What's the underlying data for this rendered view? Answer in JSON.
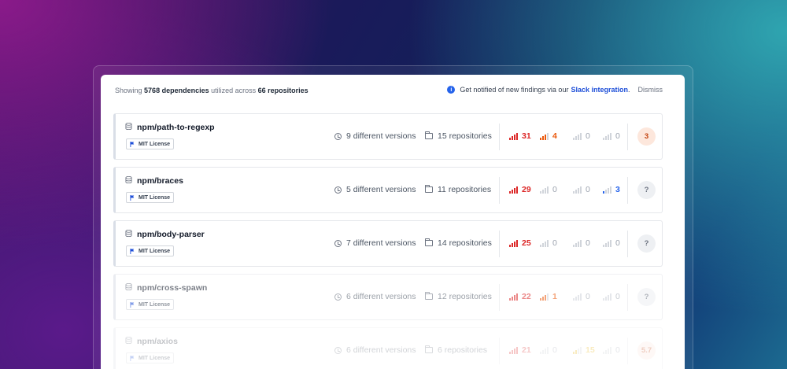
{
  "summary": {
    "prefix": "Showing",
    "count": "5768 dependencies",
    "middle": "utilized across",
    "repos": "66 repositories"
  },
  "notice": {
    "icon": "info-icon",
    "text": "Get notified of new findings via our",
    "link": "Slack integration",
    "punct": ".",
    "dismiss": "Dismiss"
  },
  "colors": {
    "critical": "#dc2626",
    "high": "#ea580c",
    "medium": "#eab308",
    "low": "#2563eb",
    "zero": "#9ca3af"
  },
  "rows": [
    {
      "name": "npm/path-to-regexp",
      "license": "MIT License",
      "versions": "9 different versions",
      "repositories": "15 repositories",
      "critical": "31",
      "high": "4",
      "medium": "0",
      "low": "0",
      "score": "3",
      "score_bg": "#fde7dc",
      "score_fg": "#c2410c"
    },
    {
      "name": "npm/braces",
      "license": "MIT License",
      "versions": "5 different versions",
      "repositories": "11 repositories",
      "critical": "29",
      "high": "0",
      "medium": "0",
      "low": "3",
      "score": "?",
      "score_bg": "#eef0f3",
      "score_fg": "#6b7280"
    },
    {
      "name": "npm/body-parser",
      "license": "MIT License",
      "versions": "7 different versions",
      "repositories": "14 repositories",
      "critical": "25",
      "high": "0",
      "medium": "0",
      "low": "0",
      "score": "?",
      "score_bg": "#eef0f3",
      "score_fg": "#6b7280"
    },
    {
      "name": "npm/cross-spawn",
      "license": "MIT License",
      "versions": "6 different versions",
      "repositories": "12 repositories",
      "critical": "22",
      "high": "1",
      "medium": "0",
      "low": "0",
      "score": "?",
      "score_bg": "#eef0f3",
      "score_fg": "#6b7280"
    },
    {
      "name": "npm/axios",
      "license": "MIT License",
      "versions": "6 different versions",
      "repositories": "6 repositories",
      "critical": "21",
      "high": "0",
      "medium": "15",
      "low": "0",
      "score": "5.7",
      "score_bg": "#fde7dc",
      "score_fg": "#c2410c"
    }
  ]
}
